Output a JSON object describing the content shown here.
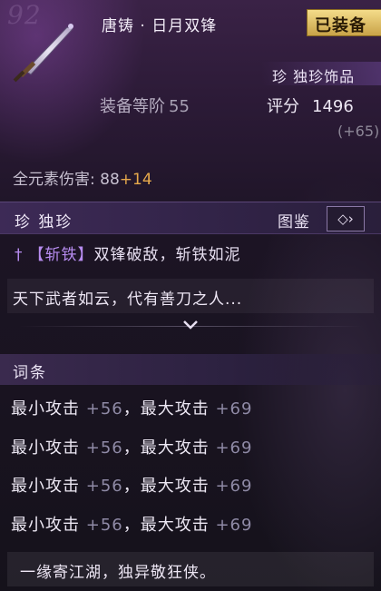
{
  "header": {
    "watermark": "92",
    "item_name": "唐铸 · 日月双锋",
    "equipped_badge": "已装备",
    "rarity_tag": "珍 独珍饰品",
    "equip_level_label": "装备等阶",
    "equip_level_value": "55",
    "score_label": "评分",
    "score_value": "1496",
    "score_delta": "(+65)"
  },
  "element_damage": {
    "label": "全元素伤害: ",
    "value": "88",
    "bonus": "+14"
  },
  "rarity_bar": {
    "label": "珍 独珍",
    "codex_label": "图鉴",
    "codex_icon": "◇›"
  },
  "passive": {
    "tag": "【斩铁】",
    "text": "双锋破敌，斩铁如泥"
  },
  "lore": "天下武者如云，代有善刀之人...",
  "affix": {
    "title": "词条",
    "rows": [
      {
        "min_label": "最小攻击 ",
        "min_value": "+56",
        "sep": "，",
        "max_label": "最大攻击 ",
        "max_value": "+69"
      },
      {
        "min_label": "最小攻击 ",
        "min_value": "+56",
        "sep": "，",
        "max_label": "最大攻击 ",
        "max_value": "+69"
      },
      {
        "min_label": "最小攻击 ",
        "min_value": "+56",
        "sep": "，",
        "max_label": "最大攻击 ",
        "max_value": "+69"
      },
      {
        "min_label": "最小攻击 ",
        "min_value": "+56",
        "sep": "，",
        "max_label": "最大攻击 ",
        "max_value": "+69"
      }
    ]
  },
  "footer": "一缘寄江湖，独异敬狂侠。",
  "colors": {
    "accent_purple": "#b78cf0",
    "bonus_orange": "#e7a94b",
    "badge_gold": "#f4dc8a"
  }
}
